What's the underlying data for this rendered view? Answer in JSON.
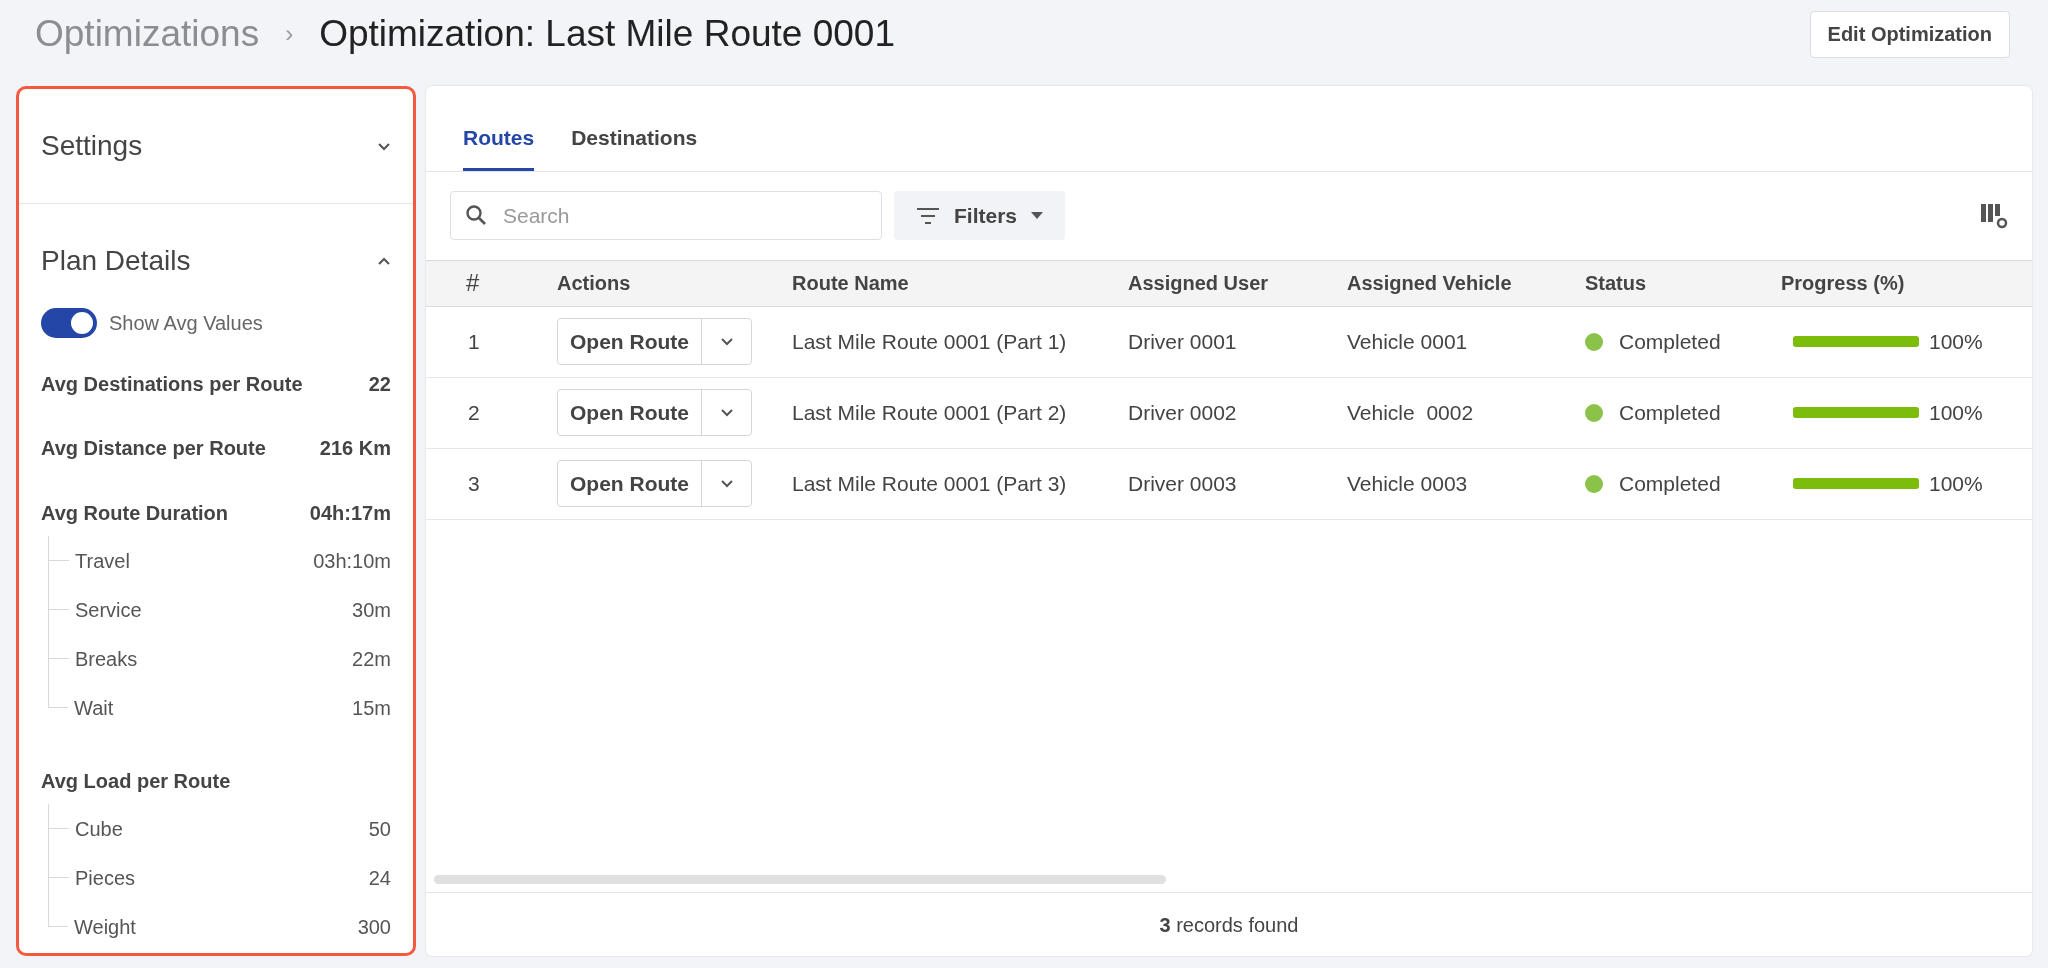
{
  "breadcrumb": {
    "parent": "Optimizations",
    "separator": "›",
    "title": "Optimization: Last Mile Route 0001"
  },
  "header_button": "Edit Optimization",
  "sidebar": {
    "sections": [
      {
        "title": "Settings",
        "expanded": false
      },
      {
        "title": "Plan Details",
        "expanded": true
      }
    ],
    "toggle": {
      "label": "Show Avg Values",
      "on": true
    },
    "metrics": [
      {
        "label": "Avg Destinations per Route",
        "value": "22"
      },
      {
        "label": "Avg Distance per Route",
        "value": "216 Km"
      },
      {
        "label": "Avg Route Duration",
        "value": "04h:17m",
        "children": [
          {
            "label": "Travel",
            "value": "03h:10m"
          },
          {
            "label": "Service",
            "value": "30m"
          },
          {
            "label": "Breaks",
            "value": "22m"
          },
          {
            "label": "Wait",
            "value": "15m"
          }
        ]
      },
      {
        "label": "Avg Load per Route",
        "children": [
          {
            "label": "Cube",
            "value": "50"
          },
          {
            "label": "Pieces",
            "value": "24"
          },
          {
            "label": "Weight",
            "value": "300"
          }
        ]
      }
    ]
  },
  "tabs": [
    {
      "label": "Routes",
      "selected": true
    },
    {
      "label": "Destinations",
      "selected": false
    }
  ],
  "search": {
    "placeholder": "Search"
  },
  "filters_button": "Filters",
  "table": {
    "columns": [
      "#",
      "Actions",
      "Route Name",
      "Assigned User",
      "Assigned Vehicle",
      "Status",
      "Progress (%)"
    ],
    "rows": [
      {
        "index": "1",
        "action": "Open Route",
        "route_name": "Last Mile Route 0001 (Part 1)",
        "user": "Driver 0001",
        "vehicle": "Vehicle 0001",
        "status": "Completed",
        "color": "#8bc34a",
        "level": 1,
        "progress": "100%"
      },
      {
        "index": "2",
        "action": "Open Route",
        "route_name": "Last Mile Route 0001 (Part 2)",
        "user": "Driver 0002",
        "vehicle": "Vehicle  0002",
        "status": "Completed",
        "color": "#8bc34a",
        "level": 1,
        "progress": "100%"
      },
      {
        "index": "3",
        "action": "Open Route",
        "route_name": "Last Mile Route 0001 (Part 3)",
        "user": "Driver 0003",
        "vehicle": "Vehicle 0003",
        "status": "Completed",
        "color": "#8bc34a",
        "level": 1,
        "progress": "100%"
      }
    ]
  },
  "footer": "**3** records found"
}
